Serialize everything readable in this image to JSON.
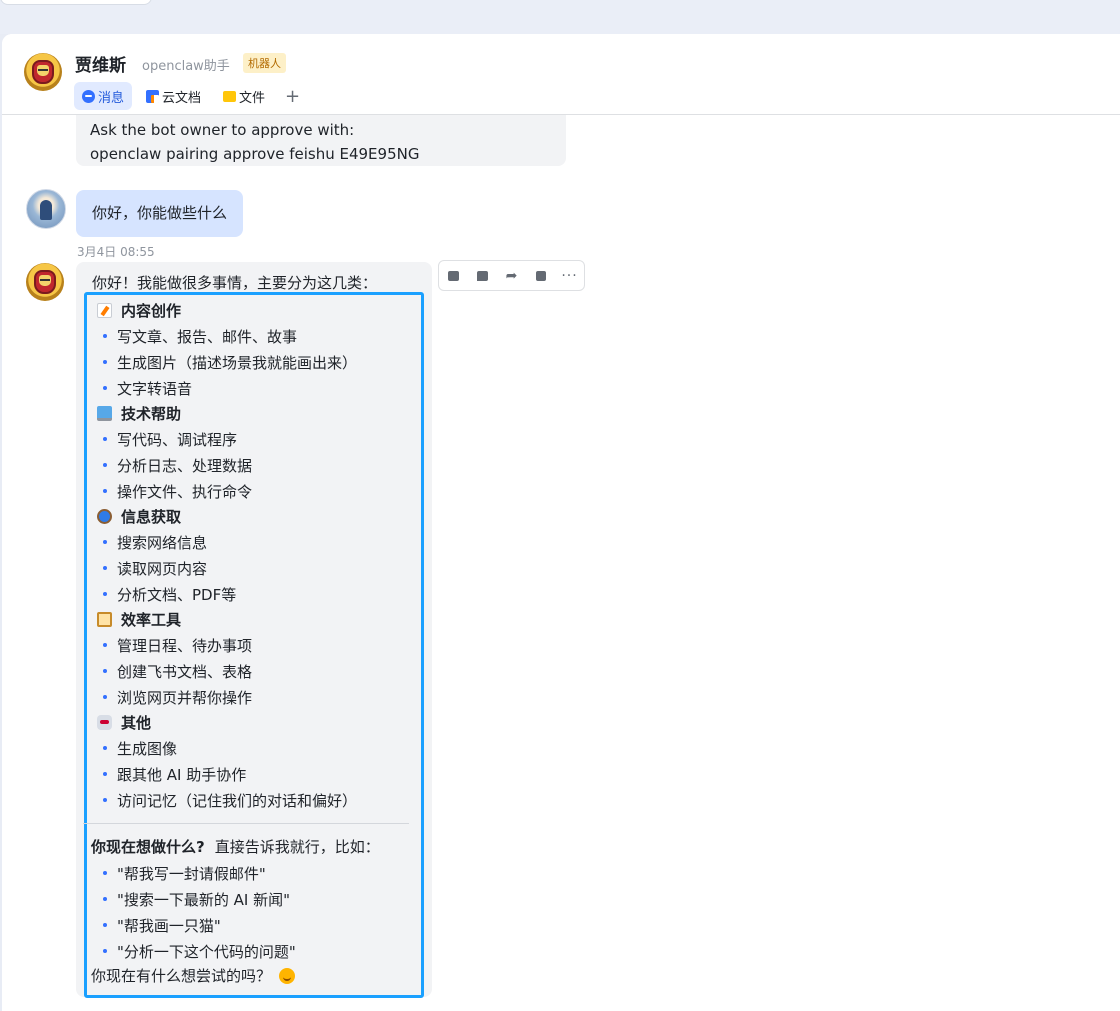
{
  "header": {
    "name": "贾维斯",
    "subtitle": "openclaw助手",
    "badge": "机器人",
    "tabs": [
      {
        "label": "消息",
        "icon": "message-icon"
      },
      {
        "label": "云文档",
        "icon": "doc-icon"
      },
      {
        "label": "文件",
        "icon": "folder-icon"
      }
    ],
    "add_tab": "+"
  },
  "previous_message": {
    "line1": "Ask the bot owner to approve with:",
    "line2": "openclaw pairing approve feishu E49E95NG"
  },
  "user_message": {
    "text": "你好，你能做些什么"
  },
  "timestamp": "3月4日 08:55",
  "bot_reply": {
    "intro": "你好！我能做很多事情，主要分为这几类：",
    "sections": [
      {
        "title": "内容创作",
        "icon": "memo-icon",
        "items": [
          "写文章、报告、邮件、故事",
          "生成图片（描述场景我就能画出来）",
          "文字转语音"
        ]
      },
      {
        "title": "技术帮助",
        "icon": "computer-icon",
        "items": [
          "写代码、调试程序",
          "分析日志、处理数据",
          "操作文件、执行命令"
        ]
      },
      {
        "title": "信息获取",
        "icon": "magnifier-icon",
        "items": [
          "搜索网络信息",
          "读取网页内容",
          "分析文档、PDF等"
        ]
      },
      {
        "title": "效率工具",
        "icon": "clipboard-icon",
        "items": [
          "管理日程、待办事项",
          "创建飞书文档、表格",
          "浏览网页并帮你操作"
        ]
      },
      {
        "title": "其他",
        "icon": "robot-icon",
        "items": [
          "生成图像",
          "跟其他 AI 助手协作",
          "访问记忆（记住我们的对话和偏好）"
        ]
      }
    ],
    "suggest_bold": "你现在想做什么?",
    "suggest_rest": "直接告诉我就行，比如：",
    "examples": [
      "\"帮我写一封请假邮件\"",
      "\"搜索一下最新的 AI 新闻\"",
      "\"帮我画一只猫\"",
      "\"分析一下这个代码的问题\""
    ],
    "closing": "你现在有什么想尝试的吗？"
  },
  "message_actions": [
    "thumbs-up-icon",
    "comment-icon",
    "forward-icon",
    "quote-icon",
    "more-icon"
  ]
}
